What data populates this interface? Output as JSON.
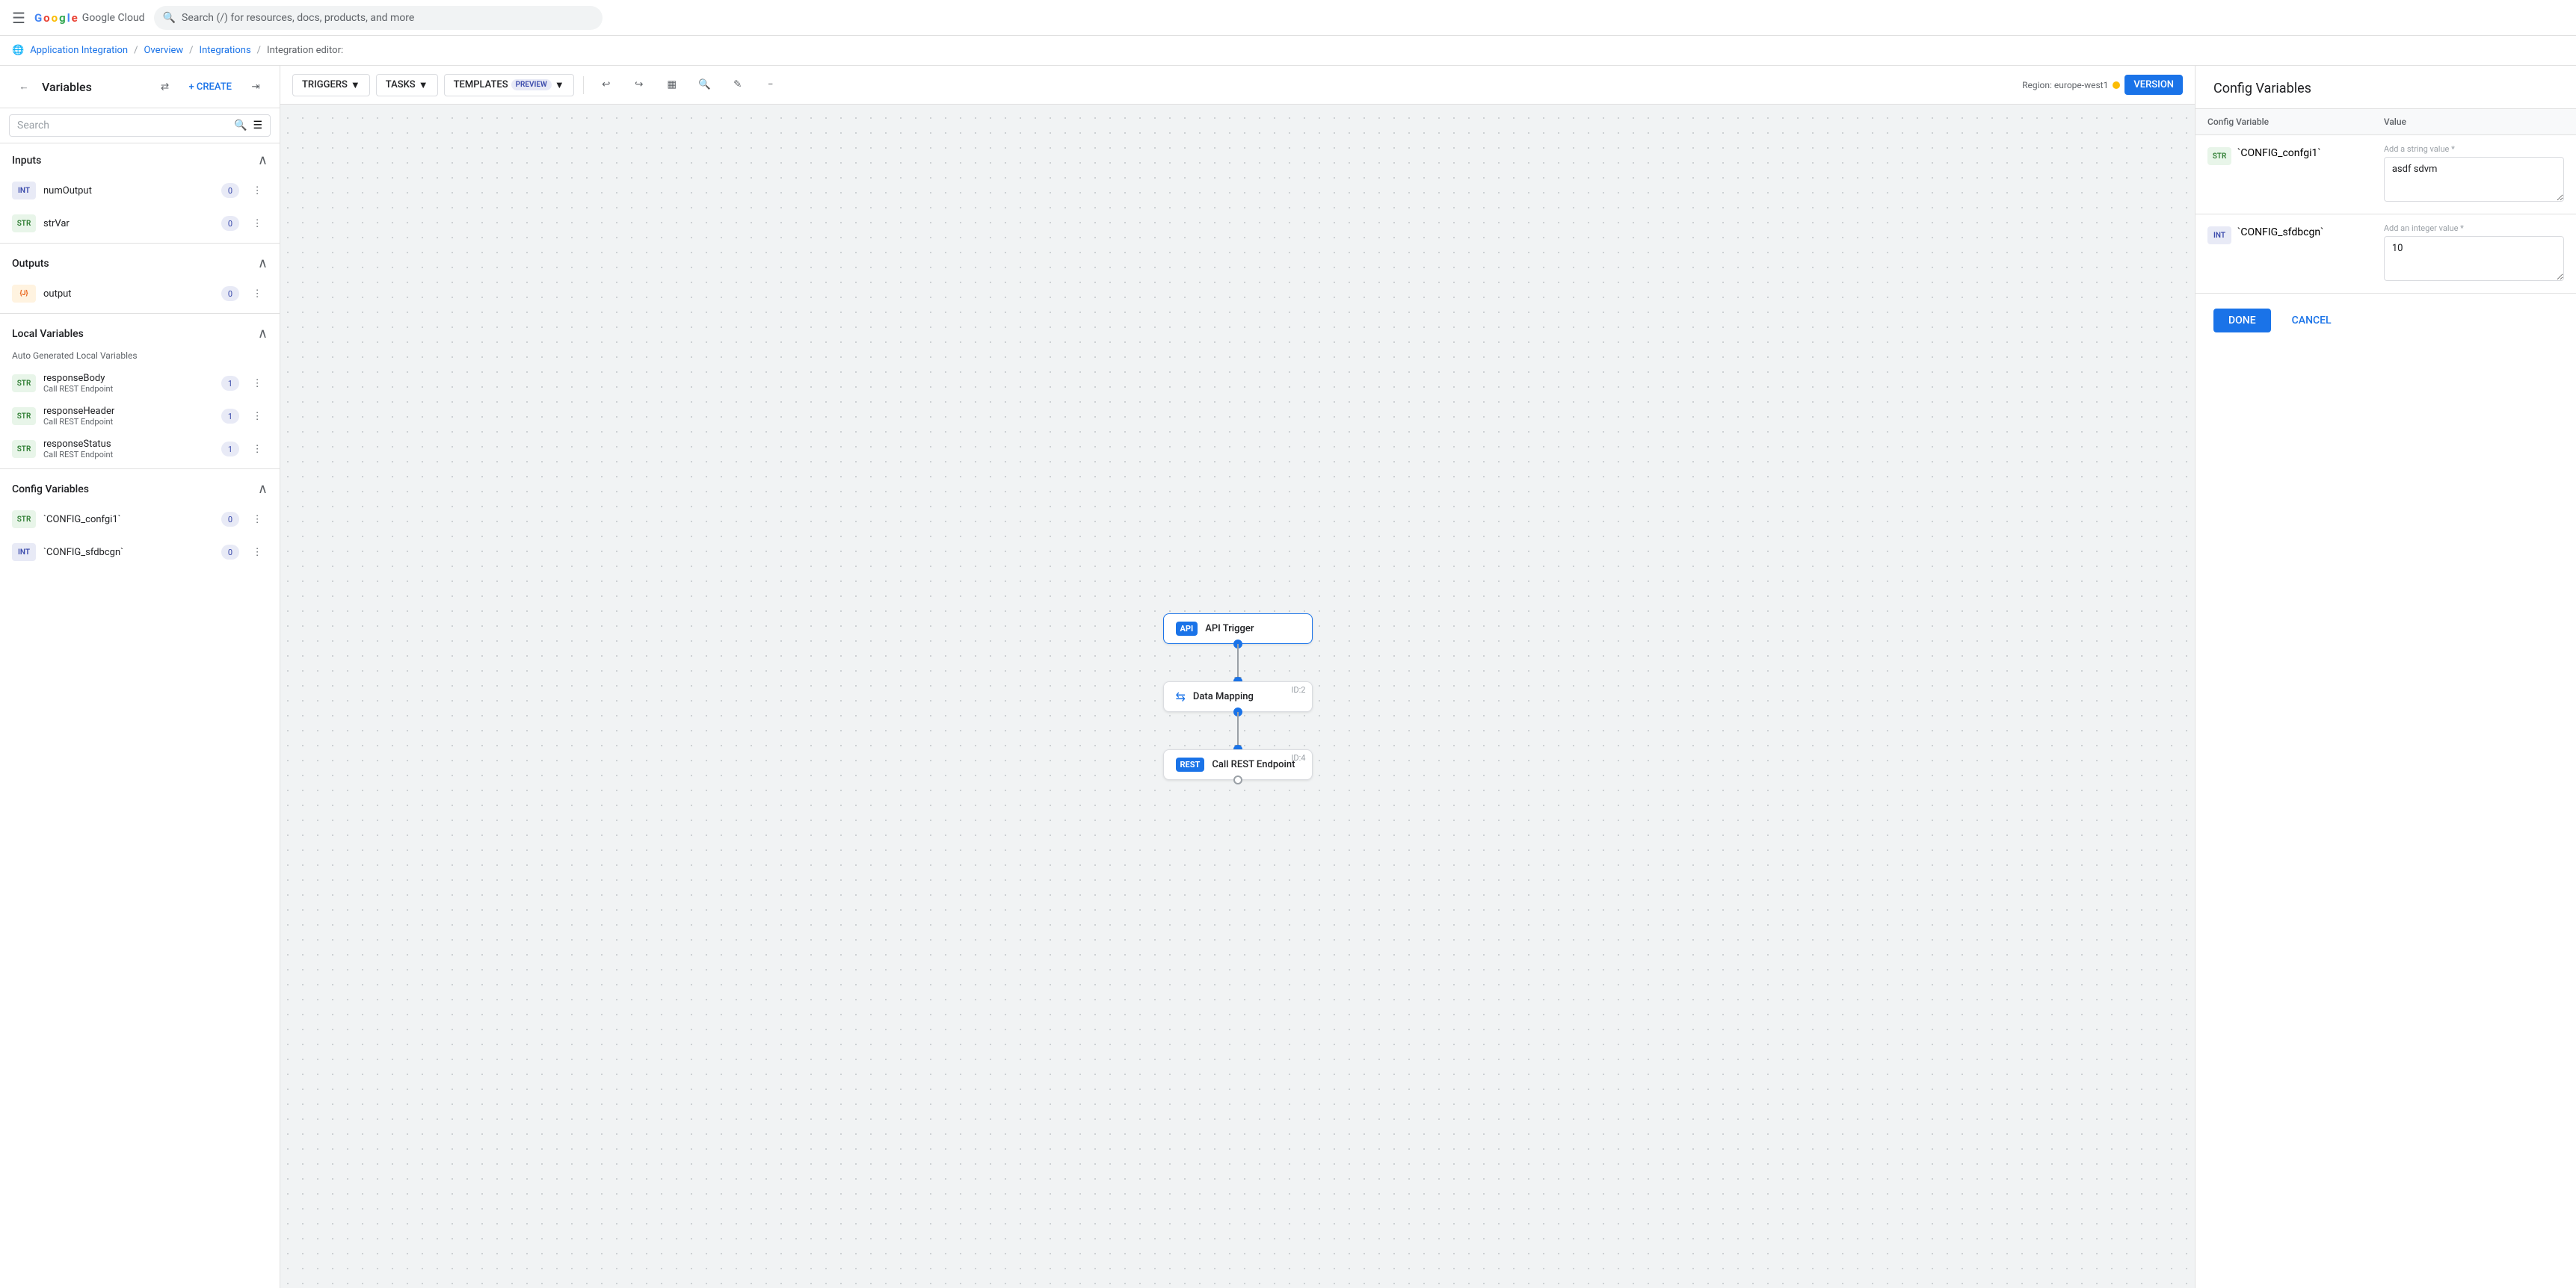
{
  "topnav": {
    "search_placeholder": "Search (/) for resources, docs, products, and more",
    "logo_text": "Google Cloud"
  },
  "breadcrumb": {
    "items": [
      {
        "label": "Application Integration",
        "link": true
      },
      {
        "label": "Overview",
        "link": true
      },
      {
        "label": "Integrations",
        "link": true
      },
      {
        "label": "Integration editor:",
        "link": false
      }
    ]
  },
  "variables_panel": {
    "title": "Variables",
    "create_label": "+ CREATE",
    "search_placeholder": "Search",
    "sections": {
      "inputs": {
        "title": "Inputs",
        "items": [
          {
            "name": "numOutput",
            "type": "INT",
            "count": "0"
          },
          {
            "name": "strVar",
            "type": "STR",
            "count": "0"
          }
        ]
      },
      "outputs": {
        "title": "Outputs",
        "items": [
          {
            "name": "output",
            "type": "OBJ",
            "count": "0"
          }
        ]
      },
      "local_variables": {
        "title": "Local Variables",
        "auto_label": "Auto Generated Local Variables",
        "items": [
          {
            "name": "responseBody",
            "sub": "Call REST Endpoint",
            "type": "STR",
            "count": "1"
          },
          {
            "name": "responseHeader",
            "sub": "Call REST Endpoint",
            "type": "STR",
            "count": "1"
          },
          {
            "name": "responseStatus",
            "sub": "Call REST Endpoint",
            "type": "STR",
            "count": "1"
          }
        ]
      },
      "config_variables": {
        "title": "Config Variables",
        "items": [
          {
            "name": "`CONFIG_confgi1`",
            "type": "STR",
            "count": "0"
          },
          {
            "name": "`CONFIG_sfdbcgn`",
            "type": "INT",
            "count": "0"
          }
        ]
      }
    }
  },
  "toolbar": {
    "triggers_label": "TRIGGERS",
    "tasks_label": "TASKS",
    "templates_label": "TEMPLATES",
    "preview_badge": "PREVIEW",
    "region_label": "Region: europe-west1",
    "version_label": "VERSION"
  },
  "workflow": {
    "nodes": [
      {
        "id": null,
        "type": "api",
        "badge": "API",
        "label": "API Trigger"
      },
      {
        "id": "ID:2",
        "type": "mapping",
        "badge": "↔",
        "label": "Data Mapping"
      },
      {
        "id": "ID:4",
        "type": "rest",
        "badge": "REST",
        "label": "Call REST Endpoint"
      }
    ]
  },
  "config_panel": {
    "title": "Config Variables",
    "col_variable": "Config Variable",
    "col_value": "Value",
    "rows": [
      {
        "type": "STR",
        "name": "`CONFIG_confgi1`",
        "value_placeholder": "Add a string value *",
        "value": "asdf sdvm"
      },
      {
        "type": "INT",
        "name": "`CONFIG_sfdbcgn`",
        "value_placeholder": "Add an integer value *",
        "value": "10"
      }
    ],
    "done_label": "DONE",
    "cancel_label": "CANCEL"
  }
}
